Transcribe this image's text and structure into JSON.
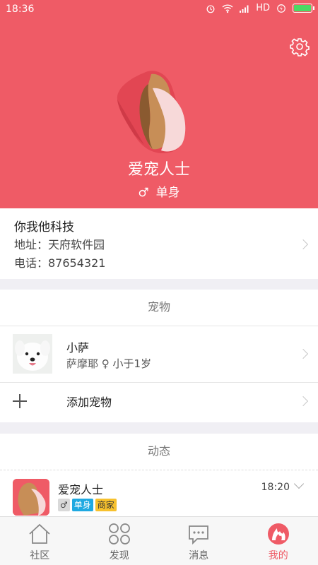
{
  "status_bar": {
    "time": "18:36",
    "network": "HD"
  },
  "profile": {
    "name": "爱宠人士",
    "gender_symbol": "♂",
    "relationship": "单身"
  },
  "company": {
    "name": "你我他科技",
    "address": "地址：天府软件园",
    "phone": "电话：87654321"
  },
  "pets_section": {
    "title": "宠物",
    "pets": [
      {
        "name": "小萨",
        "breed_info": "萨摩耶 ♀ 小于1岁"
      }
    ],
    "add_label": "添加宠物"
  },
  "feed_section": {
    "title": "动态",
    "items": [
      {
        "name": "爱宠人士",
        "time": "18:20",
        "tags": [
          "♂",
          "单身",
          "商家"
        ]
      }
    ]
  },
  "tabbar": {
    "tabs": [
      {
        "label": "社区",
        "icon": "home-icon"
      },
      {
        "label": "发现",
        "icon": "discover-grid-icon"
      },
      {
        "label": "消息",
        "icon": "message-bubble-icon"
      },
      {
        "label": "我的",
        "icon": "profile-flame-icon"
      }
    ],
    "active_index": 3
  },
  "colors": {
    "accent": "#ef5b66",
    "tag_blue": "#1fa9e1",
    "tag_yellow": "#f7c12d"
  }
}
